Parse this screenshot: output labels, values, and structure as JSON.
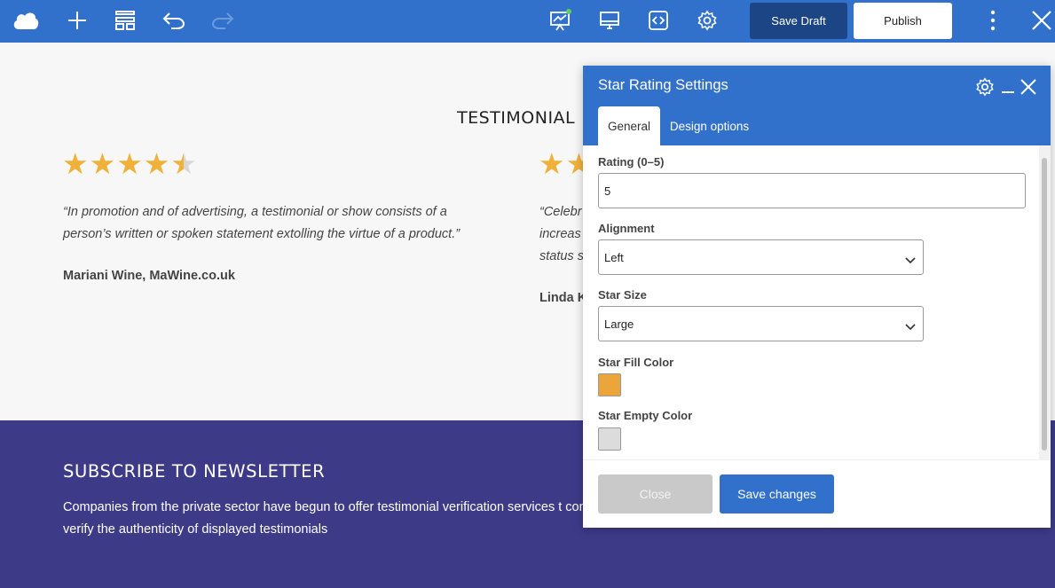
{
  "toolbar": {
    "icons": [
      "cloud-logo-icon",
      "plus-icon",
      "layout-icon",
      "undo-icon",
      "redo-icon",
      "analytics-icon",
      "desktop-preview-icon",
      "code-icon",
      "gear-icon",
      "more-vertical-icon",
      "close-icon"
    ],
    "save_draft_label": "Save Draft",
    "publish_label": "Publish"
  },
  "testimonials": {
    "title": "TESTIMONIAL",
    "items": [
      {
        "rating": 4.5,
        "quote": "“In promotion and of advertising, a testimonial or show consists of a person’s written or spoken statement extolling the virtue of a product.”",
        "author": "Mariani Wine, MaWine.co.uk"
      },
      {
        "rating": 2,
        "quote_lines": [
          "“Celebr",
          "increas",
          "status s"
        ],
        "author": "Linda K"
      }
    ]
  },
  "newsletter": {
    "title": "SUBSCRIBE TO NEWSLETTER",
    "text": "Companies from the private sector have begun to offer testimonial verification services t consumers verify the authenticity of displayed testimonials"
  },
  "settings_panel": {
    "title": "Star Rating Settings",
    "tabs": [
      {
        "label": "General",
        "active": true
      },
      {
        "label": "Design options",
        "active": false
      }
    ],
    "fields": {
      "rating": {
        "label": "Rating (0–5)",
        "value": "5"
      },
      "alignment": {
        "label": "Alignment",
        "value": "Left"
      },
      "star_size": {
        "label": "Star Size",
        "value": "Large"
      },
      "fill_color": {
        "label": "Star Fill Color",
        "value": "#eaa63b"
      },
      "empty_color": {
        "label": "Star Empty Color",
        "value": "#dcdcdc"
      }
    },
    "close_label": "Close",
    "save_label": "Save changes"
  },
  "colors": {
    "toolbar": "#3171cb",
    "save_draft": "#1c4585",
    "star_fill": "#f0b13a",
    "newsletter_bg": "#3d3a88"
  }
}
